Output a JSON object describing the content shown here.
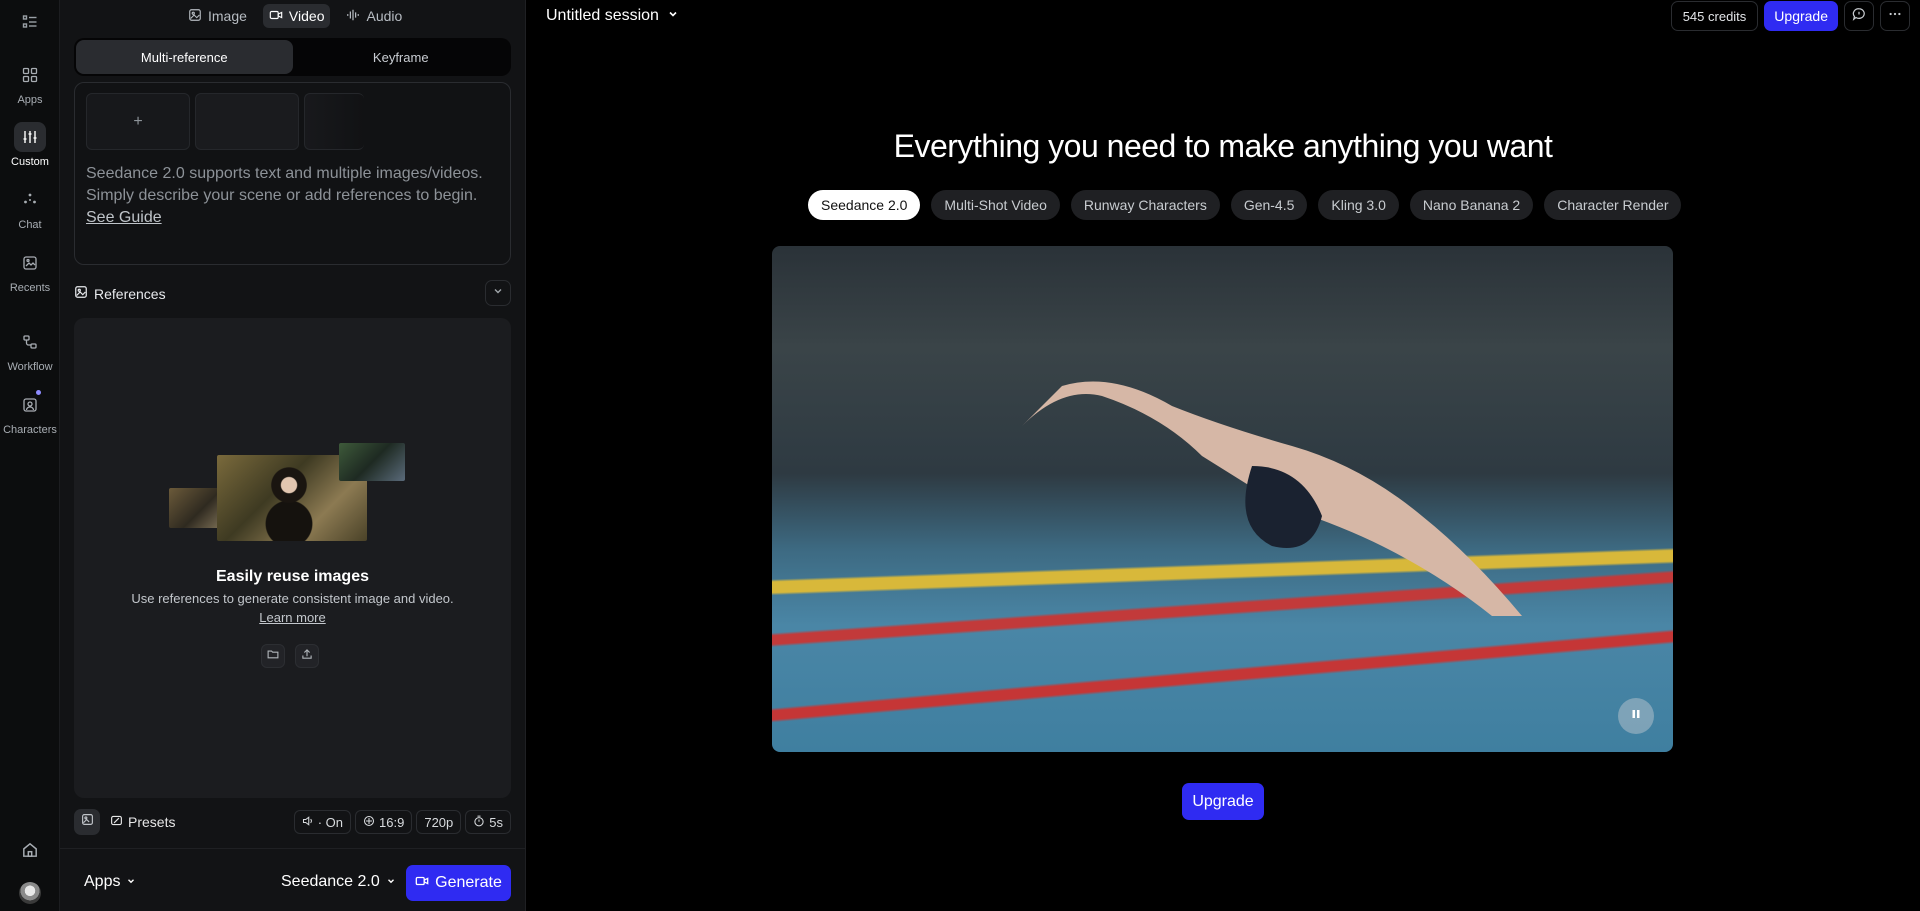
{
  "rail": {
    "items": [
      {
        "label": "Apps",
        "icon": "grid-icon"
      },
      {
        "label": "Custom",
        "icon": "sliders-icon"
      },
      {
        "label": "Chat",
        "icon": "sparkle-icon"
      },
      {
        "label": "Recents",
        "icon": "gallery-icon"
      },
      {
        "label": "Workflow",
        "icon": "workflow-icon"
      },
      {
        "label": "Characters",
        "icon": "character-icon"
      }
    ]
  },
  "modes": {
    "image": "Image",
    "video": "Video",
    "audio": "Audio"
  },
  "segment": {
    "multi": "Multi-reference",
    "keyframe": "Keyframe"
  },
  "prompt": {
    "add": "+",
    "text": "Seedance 2.0 supports text and multiple images/videos. Simply describe your scene or add references to begin.",
    "link": "See Guide"
  },
  "references": {
    "label": "References",
    "title": "Easily reuse images",
    "subtitle": "Use references to generate consistent image and video.",
    "learn_more": "Learn more"
  },
  "options": {
    "presets": "Presets",
    "audio": "· On",
    "aspect": "16:9",
    "resolution": "720p",
    "duration": "5s"
  },
  "footer": {
    "apps": "Apps",
    "model": "Seedance 2.0",
    "generate": "Generate"
  },
  "main": {
    "session": "Untitled session",
    "credits": "545 credits",
    "upgrade": "Upgrade",
    "hero_title": "Everything you need to make anything you want",
    "model_chips": [
      "Seedance 2.0",
      "Multi-Shot Video",
      "Runway Characters",
      "Gen-4.5",
      "Kling 3.0",
      "Nano Banana 2",
      "Character Render"
    ],
    "upgrade_cta": "Upgrade"
  },
  "colors": {
    "accent": "#2f2bf2",
    "background": "#000000",
    "panel": "#121315"
  }
}
